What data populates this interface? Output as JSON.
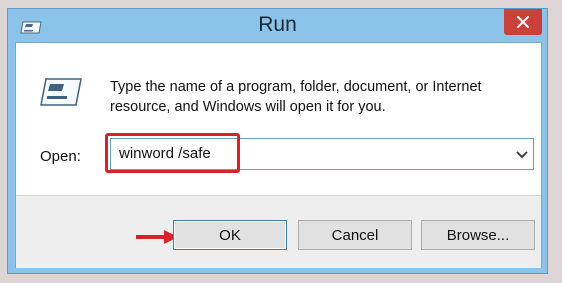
{
  "window": {
    "title": "Run",
    "icons": {
      "app": "run-icon",
      "close": "close-icon"
    }
  },
  "content": {
    "icon": "run-program-icon",
    "description": "Type the name of a program, folder, document, or Internet\nresource, and Windows will open it for you."
  },
  "open_field": {
    "label": "Open:",
    "value": "winword /safe",
    "dropdown_icon": "chevron-down-icon"
  },
  "buttons": {
    "ok": "OK",
    "cancel": "Cancel",
    "browse": "Browse..."
  },
  "annotations": {
    "highlight_color": "#d8222b",
    "arrow_color": "#d8222b"
  },
  "colors": {
    "frame": "#8cc3e8",
    "close_button": "#c8413a",
    "footer": "#eeeeee"
  }
}
